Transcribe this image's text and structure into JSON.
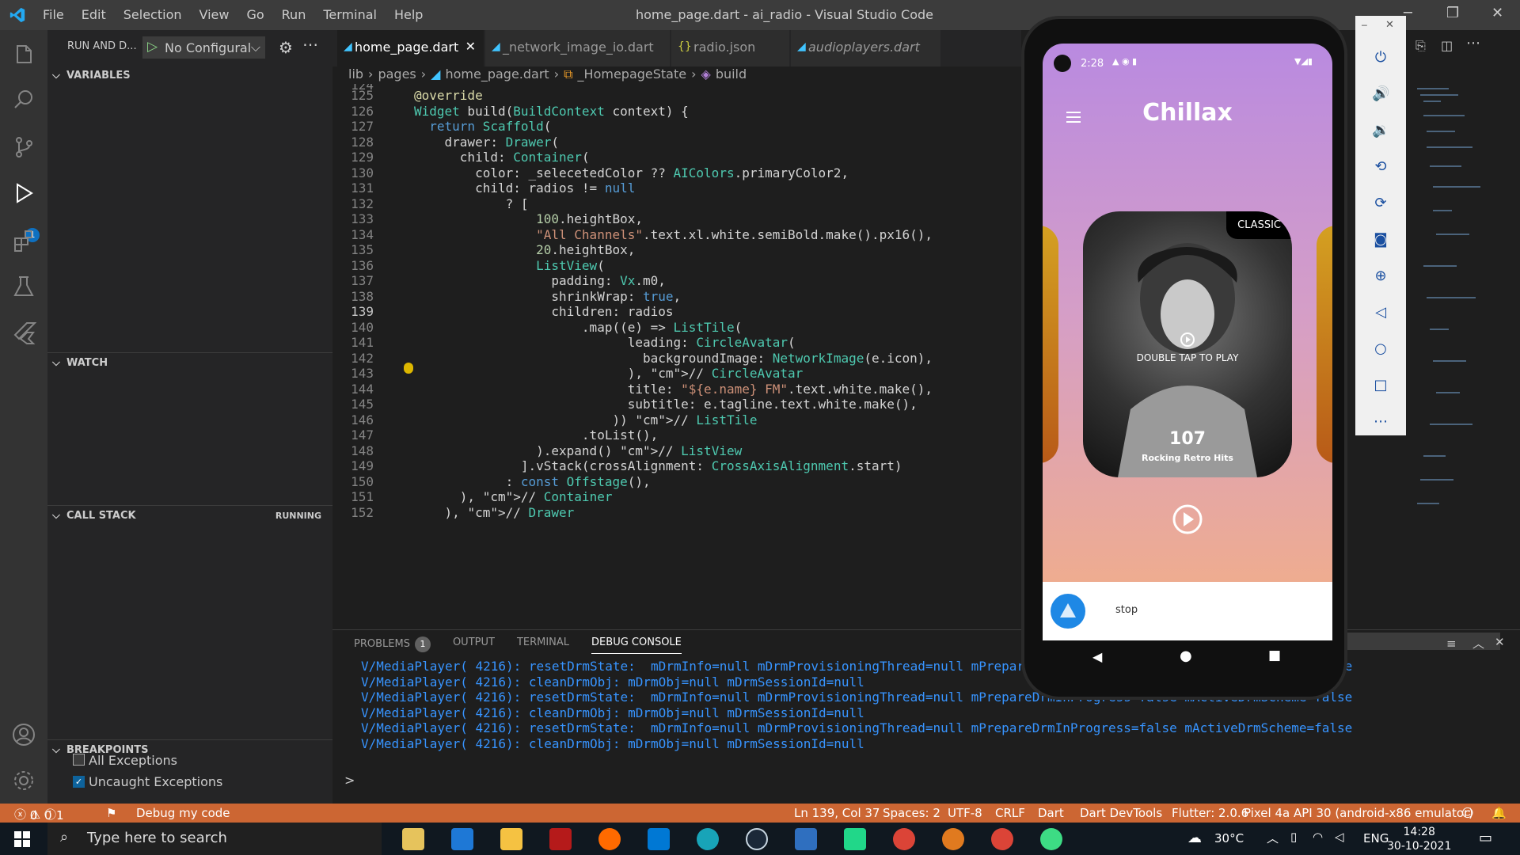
{
  "window": {
    "title": "home_page.dart - ai_radio - Visual Studio Code"
  },
  "menu": [
    "File",
    "Edit",
    "Selection",
    "View",
    "Go",
    "Run",
    "Terminal",
    "Help"
  ],
  "sidebar": {
    "run_label": "RUN AND D...",
    "config": "No Configural",
    "variables": "VARIABLES",
    "watch": "WATCH",
    "callstack": "CALL STACK",
    "callstack_state": "RUNNING",
    "breakpoints": "BREAKPOINTS",
    "bp_items": [
      {
        "label": "All Exceptions",
        "checked": false
      },
      {
        "label": "Uncaught Exceptions",
        "checked": true
      }
    ]
  },
  "activity_badge": "1",
  "tabs": [
    {
      "label": "home_page.dart",
      "active": true
    },
    {
      "label": "_network_image_io.dart",
      "active": false
    },
    {
      "label": "radio.json",
      "active": false
    },
    {
      "label": "audioplayers.dart",
      "active": false
    }
  ],
  "breadcrumb": [
    "lib",
    "pages",
    "home_page.dart",
    "_HomepageState",
    "build"
  ],
  "code": {
    "first_visible": "124",
    "lines": [
      {
        "n": "125",
        "t": "@override"
      },
      {
        "n": "126",
        "t": "Widget build(BuildContext context) {"
      },
      {
        "n": "127",
        "t": "  return Scaffold("
      },
      {
        "n": "128",
        "t": "    drawer: Drawer("
      },
      {
        "n": "129",
        "t": "      child: Container("
      },
      {
        "n": "130",
        "t": "        color: _selecetedColor ?? AIColors.primaryColor2,"
      },
      {
        "n": "131",
        "t": "        child: radios != null"
      },
      {
        "n": "132",
        "t": "            ? ["
      },
      {
        "n": "133",
        "t": "                100.heightBox,"
      },
      {
        "n": "134",
        "t": "                \"All Channels\".text.xl.white.semiBold.make().px16(),"
      },
      {
        "n": "135",
        "t": "                20.heightBox,"
      },
      {
        "n": "136",
        "t": "                ListView("
      },
      {
        "n": "137",
        "t": "                  padding: Vx.m0,"
      },
      {
        "n": "138",
        "t": "                  shrinkWrap: true,"
      },
      {
        "n": "139",
        "t": "                  children: radios"
      },
      {
        "n": "140",
        "t": "                      .map((e) => ListTile("
      },
      {
        "n": "141",
        "t": "                            leading: CircleAvatar("
      },
      {
        "n": "142",
        "t": "                              backgroundImage: NetworkImage(e.icon),"
      },
      {
        "n": "143",
        "t": "                            ), // CircleAvatar"
      },
      {
        "n": "144",
        "t": "                            title: \"${e.name} FM\".text.white.make(),"
      },
      {
        "n": "145",
        "t": "                            subtitle: e.tagline.text.white.make(),"
      },
      {
        "n": "146",
        "t": "                          )) // ListTile"
      },
      {
        "n": "147",
        "t": "                      .toList(),"
      },
      {
        "n": "148",
        "t": "                ).expand() // ListView"
      },
      {
        "n": "149",
        "t": "              ].vStack(crossAlignment: CrossAxisAlignment.start)"
      },
      {
        "n": "150",
        "t": "            : const Offstage(),"
      },
      {
        "n": "151",
        "t": "      ), // Container"
      },
      {
        "n": "152",
        "t": "    ), // Drawer"
      }
    ]
  },
  "panel": {
    "tabs": [
      "PROBLEMS",
      "OUTPUT",
      "TERMINAL",
      "DEBUG CONSOLE"
    ],
    "problems_count": "1",
    "log": [
      "V/MediaPlayer( 4216): resetDrmState:  mDrmInfo=null mDrmProvisioningThread=null mPrepareDrmInProgress=false mActiveDrmScheme=false",
      "V/MediaPlayer( 4216): cleanDrmObj: mDrmObj=null mDrmSessionId=null",
      "V/MediaPlayer( 4216): resetDrmState:  mDrmInfo=null mDrmProvisioningThread=null mPrepareDrmInProgress=false mActiveDrmScheme=false",
      "V/MediaPlayer( 4216): cleanDrmObj: mDrmObj=null mDrmSessionId=null",
      "V/MediaPlayer( 4216): resetDrmState:  mDrmInfo=null mDrmProvisioningThread=null mPrepareDrmInProgress=false mActiveDrmScheme=false",
      "V/MediaPlayer( 4216): cleanDrmObj: mDrmObj=null mDrmSessionId=null"
    ],
    "prompt": ">"
  },
  "status": {
    "errors": "0",
    "warnings": "0",
    "info": "1",
    "debug": "Debug my code",
    "position": "Ln 139, Col 37",
    "spaces": "Spaces: 2",
    "encoding": "UTF-8",
    "eol": "CRLF",
    "lang": "Dart",
    "devtools": "Dart DevTools",
    "flutter": "Flutter: 2.0.6",
    "device": "Pixel 4a API 30 (android-x86 emulator)"
  },
  "phone": {
    "time": "2:28",
    "app_title": "Chillax",
    "card_tag": "CLASSIC",
    "card_hint": "DOUBLE TAP TO PLAY",
    "card_number": "107",
    "card_name": "Rocking Retro Hits",
    "bottom_text": "stop"
  },
  "taskbar": {
    "search": "Type here to search",
    "temp": "30°C",
    "lang": "ENG",
    "time": "14:28",
    "date": "30-10-2021"
  },
  "colors": {
    "status_bar": "#cc6633",
    "accent": "#0e70c0"
  }
}
